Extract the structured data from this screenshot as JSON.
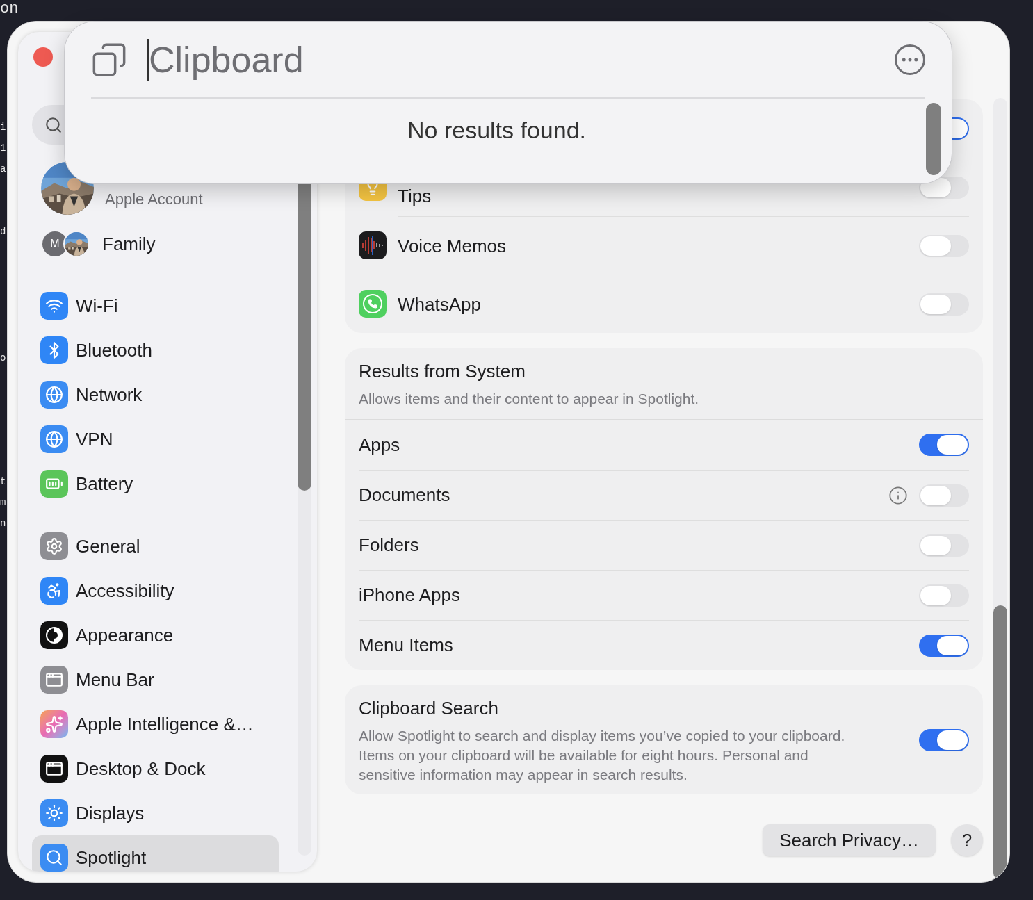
{
  "terminal": {
    "lines": [
      "on",
      "i",
      "1",
      "a",
      "d",
      "o",
      "t",
      "m",
      "n"
    ]
  },
  "sidebar": {
    "account": {
      "subtitle": "Apple Account"
    },
    "family": {
      "label": "Family",
      "initial": "M"
    },
    "groups": [
      [
        {
          "label": "Wi-Fi",
          "selected": false
        },
        {
          "label": "Bluetooth",
          "selected": false
        },
        {
          "label": "Network",
          "selected": false
        },
        {
          "label": "VPN",
          "selected": false
        },
        {
          "label": "Battery",
          "selected": false
        }
      ],
      [
        {
          "label": "General",
          "selected": false
        },
        {
          "label": "Accessibility",
          "selected": false
        },
        {
          "label": "Appearance",
          "selected": false
        },
        {
          "label": "Menu Bar",
          "selected": false
        },
        {
          "label": "Apple Intelligence &…",
          "selected": false
        },
        {
          "label": "Desktop & Dock",
          "selected": false
        },
        {
          "label": "Displays",
          "selected": false
        },
        {
          "label": "Spotlight",
          "selected": true
        }
      ]
    ]
  },
  "app_results": [
    {
      "on": true
    },
    {
      "name": "Tips",
      "on": false
    },
    {
      "name": "Voice Memos",
      "on": false
    },
    {
      "name": "WhatsApp",
      "on": false
    }
  ],
  "system_results": {
    "title": "Results from System",
    "description": "Allows items and their content to appear in Spotlight.",
    "items": [
      {
        "name": "Apps",
        "on": true,
        "info": false
      },
      {
        "name": "Documents",
        "on": false,
        "info": true
      },
      {
        "name": "Folders",
        "on": false,
        "info": false
      },
      {
        "name": "iPhone Apps",
        "on": false,
        "info": false
      },
      {
        "name": "Menu Items",
        "on": true,
        "info": false
      }
    ]
  },
  "clipboard_search": {
    "title": "Clipboard Search",
    "description": "Allow Spotlight to search and display items you’ve copied to your clipboard. Items on your clipboard will be available for eight hours. Personal and sensitive information may appear in search results.",
    "on": true
  },
  "footer": {
    "privacy_button": "Search Privacy…",
    "help_button": "?"
  },
  "spotlight": {
    "query": "Clipboard",
    "message": "No results found."
  }
}
